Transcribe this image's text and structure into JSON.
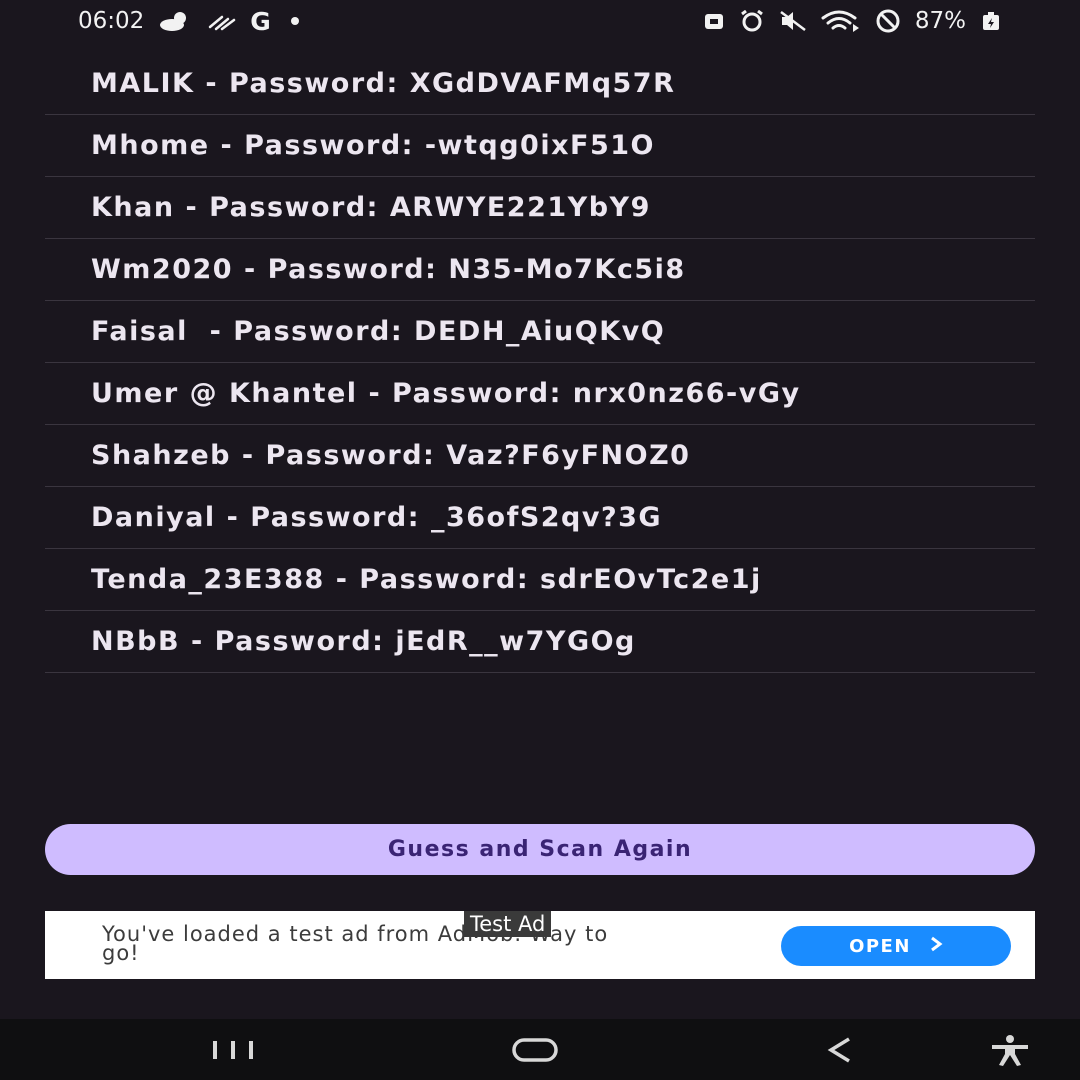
{
  "status_bar": {
    "time": "06:02",
    "battery": "87%",
    "left_icons": [
      "weather-icon",
      "haze-icon",
      "google-icon",
      "notification-dot-icon"
    ],
    "right_icons": [
      "battery-saver-icon",
      "alarm-icon",
      "mute-icon",
      "wifi-icon",
      "do-not-disturb-icon",
      "battery-icon"
    ]
  },
  "networks": [
    {
      "text": "MALIK - Password: XGdDVAFMq57R"
    },
    {
      "text": "Mhome - Password: -wtqg0ixF51O"
    },
    {
      "text": "Khan - Password: ARWYE221YbY9"
    },
    {
      "text": "Wm2020 - Password: N35-Mo7Kc5i8"
    },
    {
      "text": "Faisal  - Password: DEDH_AiuQKvQ"
    },
    {
      "text": "Umer @ Khantel - Password: nrx0nz66-vGy"
    },
    {
      "text": "Shahzeb - Password: Vaz?F6yFNOZ0"
    },
    {
      "text": "Daniyal - Password: _36ofS2qv?3G"
    },
    {
      "text": "Tenda_23E388 - Password: sdrEOvTc2e1j"
    },
    {
      "text": "NBbB - Password: jEdR__w7YGOg"
    }
  ],
  "action_button": {
    "label": "Guess and Scan Again"
  },
  "ad": {
    "label": "Test Ad",
    "message": "You've loaded a test ad from AdMob. Way to go!",
    "open_label": "OPEN"
  },
  "colors": {
    "background": "#1a161e",
    "button": "#cfbcff",
    "button_text": "#3a2474",
    "ad_open": "#1a8cff"
  }
}
